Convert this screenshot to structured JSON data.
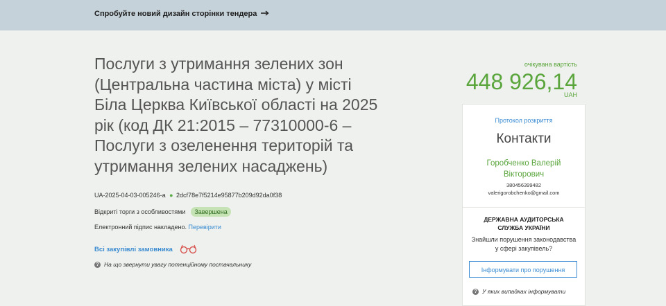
{
  "banner": {
    "link_text": "Спробуйте новий дизайн сторінки тендера",
    "icon": "arrow-right-icon"
  },
  "tender": {
    "title": "Послуги з утримання зелених зон (Центральна частина міста) у місті Біла Церква Київської області на 2025 рік (код ДК 21:2015 – 77310000-6 – Послуги з озеленення територій та утримання зелених насаджень)",
    "id": "UA-2025-04-03-005246-a",
    "hash": "2dcf78e7f5214e95877b209d92da0f38",
    "procedure": "Відкриті торги з особливостями",
    "status": "Завершена",
    "signature_text": "Електронний підпис накладено.",
    "verify_link": "Перевірити",
    "buyer_link": "Всі закупівлі замовника",
    "hint": "На що звернути увагу потенційному постачальнику"
  },
  "value": {
    "label": "очікувана вартість",
    "amount": "448 926,14",
    "currency": "UAH"
  },
  "contacts": {
    "protocol_link": "Протокол розкриття",
    "title": "Контакти",
    "name": "Горобченко Валерій Вікторович",
    "phone": "380456399482",
    "email": "valerigorobchenko@gmail.com"
  },
  "audit": {
    "org": "ДЕРЖАВНА АУДИТОРСЬКА СЛУЖБА УКРАЇНИ",
    "question": "Знайшли порушення законодавства у сфері закупівель?",
    "button": "Інформувати про порушення",
    "hint": "У яких випадках інформувати"
  },
  "colors": {
    "accent_green": "#5aa53c",
    "link_blue": "#3a8bd2",
    "banner_bg": "#c6d2d9",
    "page_bg": "#eef1ed"
  }
}
